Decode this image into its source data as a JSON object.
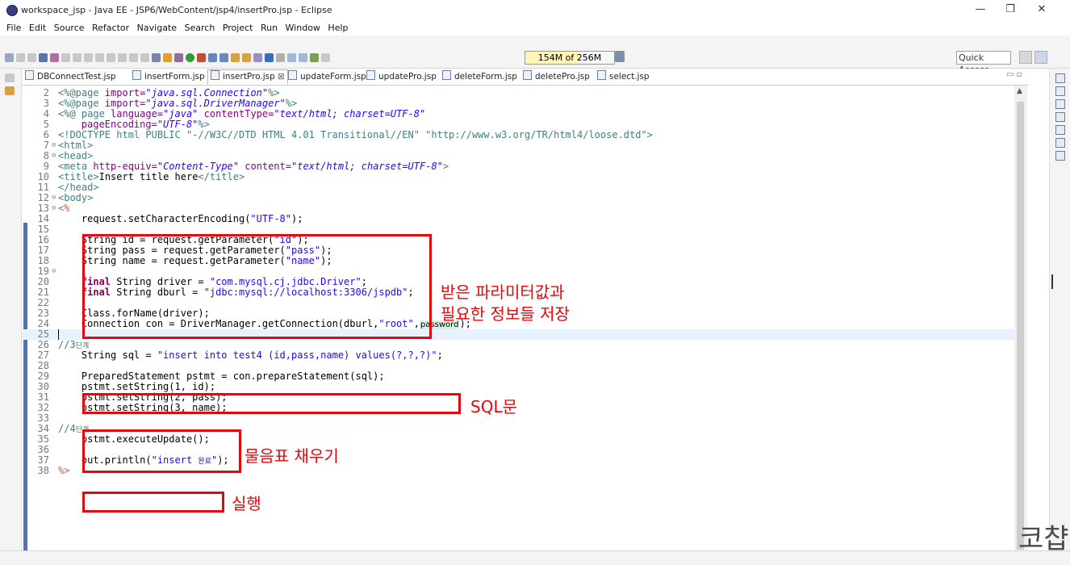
{
  "window": {
    "title": "workspace_jsp - Java EE - JSP6/WebContent/jsp4/insertPro.jsp - Eclipse",
    "minimize": "—",
    "restore": "❐",
    "close": "✕"
  },
  "menu": [
    "File",
    "Edit",
    "Source",
    "Refactor",
    "Navigate",
    "Search",
    "Project",
    "Run",
    "Window",
    "Help"
  ],
  "toolbar": {
    "heap": "154M of 256M",
    "quick_access": "Quick Access"
  },
  "tabs": [
    {
      "label": "DBConnectTest.jsp",
      "active": false
    },
    {
      "label": "insertForm.jsp",
      "active": false
    },
    {
      "label": "insertPro.jsp",
      "active": true,
      "close": "⊠"
    },
    {
      "label": "updateForm.jsp",
      "active": false
    },
    {
      "label": "updatePro.jsp",
      "active": false
    },
    {
      "label": "deleteForm.jsp",
      "active": false
    },
    {
      "label": "deletePro.jsp",
      "active": false
    },
    {
      "label": "select.jsp",
      "active": false
    }
  ],
  "code": {
    "n": [
      "2",
      "3",
      "4",
      "5",
      "6",
      "7",
      "8",
      "9",
      "10",
      "11",
      "12",
      "13",
      "14",
      "15",
      "16",
      "17",
      "18",
      "19",
      "20",
      "21",
      "22",
      "23",
      "24",
      "25",
      "26",
      "27",
      "28",
      "29",
      "30",
      "31",
      "32",
      "33",
      "34",
      "35",
      "36",
      "37",
      "38"
    ],
    "l2": [
      "<%@page ",
      "import=",
      "\"java.sql.Connection\"",
      "%>"
    ],
    "l3": [
      "<%@page ",
      "import=",
      "\"java.sql.DriverManager\"",
      "%>"
    ],
    "l4": [
      "<%@ page ",
      "language=",
      "\"java\"",
      "contentType=",
      "\"text/html; charset=UTF-8\""
    ],
    "l5": [
      "pageEncoding=",
      "\"UTF-8\"",
      "%>"
    ],
    "l6": [
      "<!DOCTYPE html PUBLIC \"-//W3C//DTD HTML 4.01 Transitional//EN\" \"http://www.w3.org/TR/html4/loose.dtd\">"
    ],
    "l7": [
      "<",
      "html",
      ">"
    ],
    "l8": [
      "<",
      "head",
      ">"
    ],
    "l9": [
      "<",
      "meta",
      "http-equiv=",
      "\"Content-Type\"",
      "content=",
      "\"text/html; charset=UTF-8\"",
      ">"
    ],
    "l10": [
      "<",
      "title",
      ">",
      "Insert title here",
      "</",
      "title",
      ">"
    ],
    "l11": [
      "</",
      "head",
      ">"
    ],
    "l12": [
      "<",
      "body",
      ">"
    ],
    "l13": [
      "<%"
    ],
    "l14": [
      "request.setCharacterEncoding(",
      "\"UTF-8\"",
      ");"
    ],
    "l16": [
      "String id = request.getParameter(",
      "\"id\"",
      ");"
    ],
    "l17": [
      "String pass = request.getParameter(",
      "\"pass\"",
      ");"
    ],
    "l18": [
      "String name = request.getParameter(",
      "\"name\"",
      ");"
    ],
    "l20": [
      "final",
      "String driver = ",
      "\"com.mysql.cj.jdbc.Driver\"",
      ";"
    ],
    "l21": [
      "final",
      "String dburl = ",
      "\"jdbc:mysql://localhost:3306/jspdb\"",
      ";"
    ],
    "l23": [
      "Class.forName(driver);"
    ],
    "l24": [
      "Connection con = DriverManager.getConnection(dburl,",
      "\"root\"",
      ",",
      "password",
      ");"
    ],
    "l26": [
      "//3",
      "단계"
    ],
    "l27": [
      "String sql = ",
      "\"insert into test4 (id,pass,name) values(?,?,?)\"",
      ";"
    ],
    "l29": [
      "PreparedStatement pstmt = con.prepareStatement(sql);"
    ],
    "l30": [
      "pstmt.setString(1, id);"
    ],
    "l31": [
      "pstmt.setString(2, pass);"
    ],
    "l32": [
      "pstmt.setString(3, name);"
    ],
    "l34": [
      "//4",
      "단계"
    ],
    "l35": [
      "pstmt.executeUpdate();"
    ],
    "l37": [
      "out.println(",
      "\"insert ",
      "완료",
      "\"",
      ");"
    ],
    "l38": [
      "%>"
    ]
  },
  "annotations": {
    "params": [
      "받은 파라미터값과",
      "필요한 정보들 저장"
    ],
    "sql": "SQL문",
    "qmarks": "물음표 채우기",
    "exec": "실행"
  },
  "watermark": "코챱",
  "colors": {
    "annotation_red": "#e3070e",
    "keyword": "#7f0055",
    "string": "#2a00ff",
    "tag": "#3f7f7f",
    "attr": "#7f007f",
    "comment": "#3f7f5f"
  }
}
